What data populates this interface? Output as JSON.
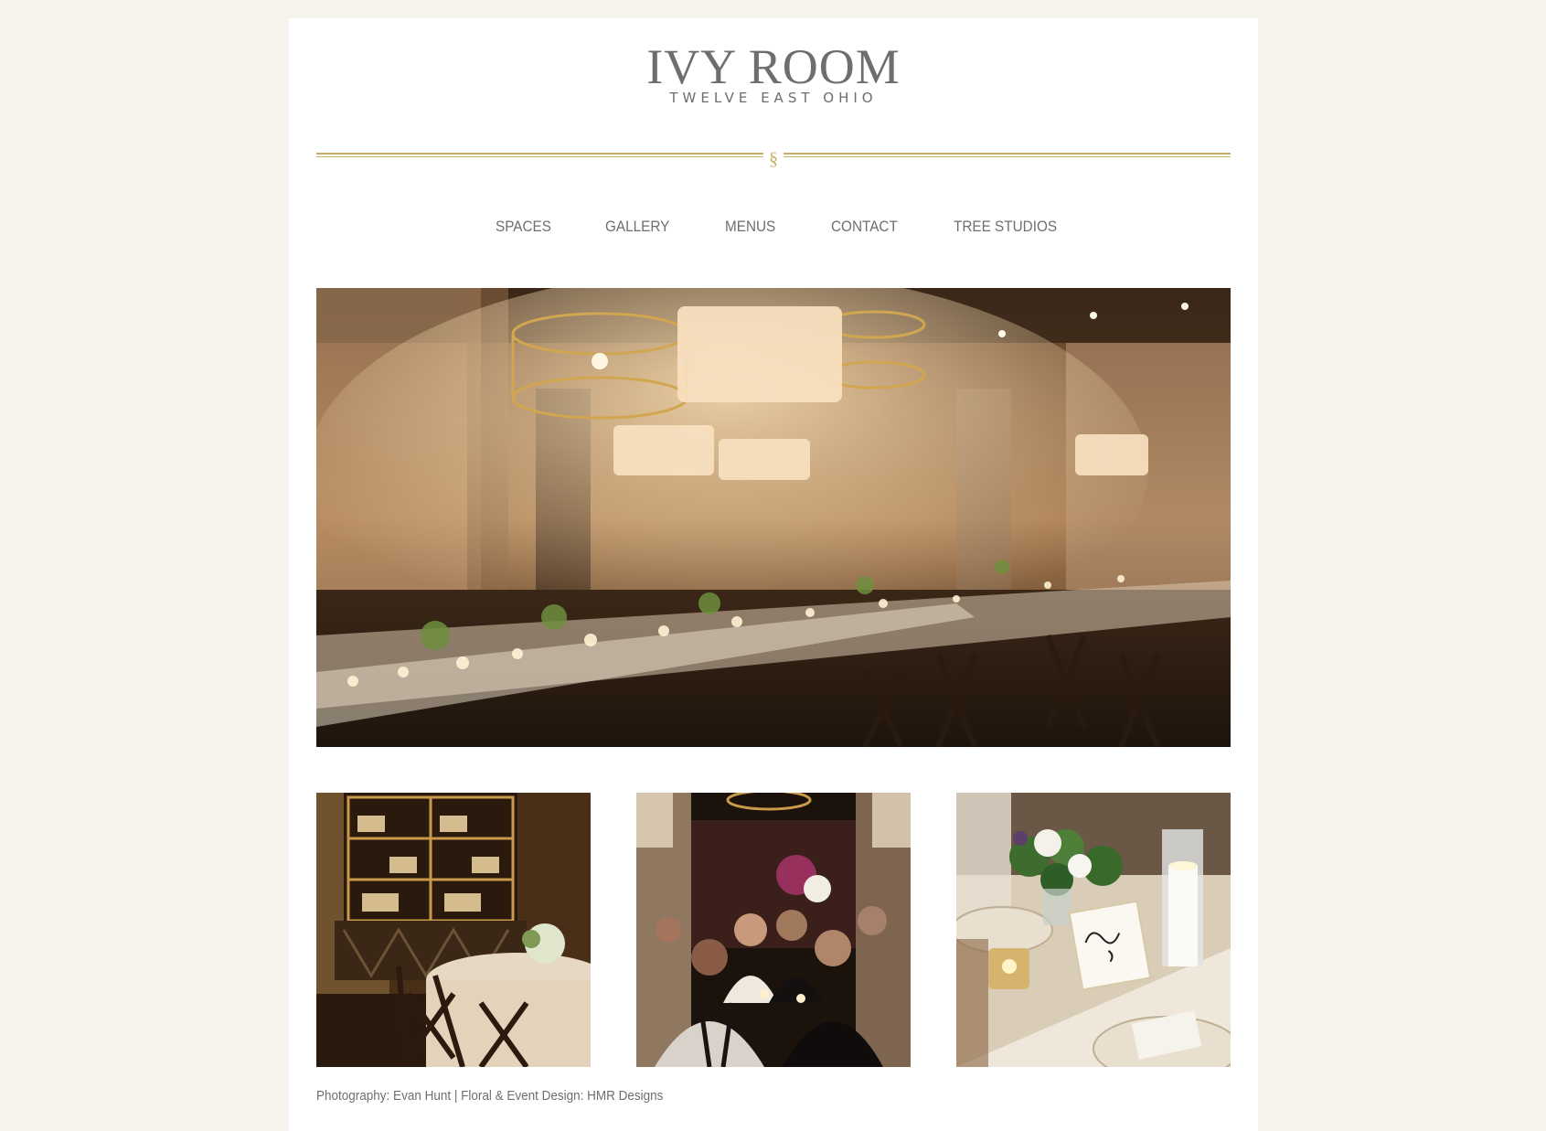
{
  "brand": {
    "title": "IVY ROOM",
    "subtitle": "TWELVE EAST OHIO",
    "divider_glyph": "§",
    "accent_color": "#c9ac66",
    "text_color": "#6d6e70"
  },
  "nav": {
    "items": [
      {
        "label": "SPACES"
      },
      {
        "label": "GALLERY"
      },
      {
        "label": "MENUS"
      },
      {
        "label": "CONTACT"
      },
      {
        "label": "TREE STUDIOS"
      }
    ]
  },
  "gallery": {
    "hero_icon": "photo-icon",
    "thumbnails": 3
  },
  "caption": "Photography: Evan Hunt | Floral & Event Design: HMR Designs"
}
